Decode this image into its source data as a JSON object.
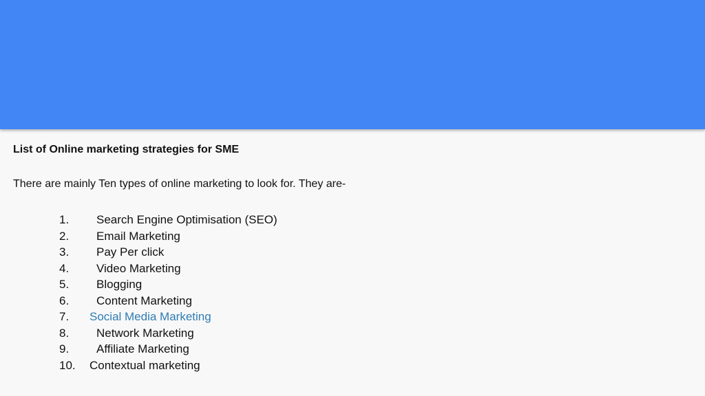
{
  "colors": {
    "header": "#4285f4",
    "background": "#f8f8f8",
    "text": "#111111",
    "link": "#2e7db5"
  },
  "slide": {
    "title": "List of Online marketing strategies for SME",
    "intro": "There are mainly Ten types of online marketing to look for. They are-",
    "items": [
      {
        "number": "1.",
        "label": "Search Engine Optimisation (SEO)"
      },
      {
        "number": "2.",
        "label": "Email Marketing"
      },
      {
        "number": "3.",
        "label": "Pay Per click"
      },
      {
        "number": "4.",
        "label": "Video Marketing"
      },
      {
        "number": "5.",
        "label": "Blogging"
      },
      {
        "number": "6.",
        "label": "Content Marketing"
      },
      {
        "number": "7.",
        "label": "Social Media Marketing"
      },
      {
        "number": "8.",
        "label": "Network Marketing"
      },
      {
        "number": "9.",
        "label": "Affiliate Marketing"
      },
      {
        "number": "10.",
        "label": "Contextual marketing"
      }
    ]
  }
}
